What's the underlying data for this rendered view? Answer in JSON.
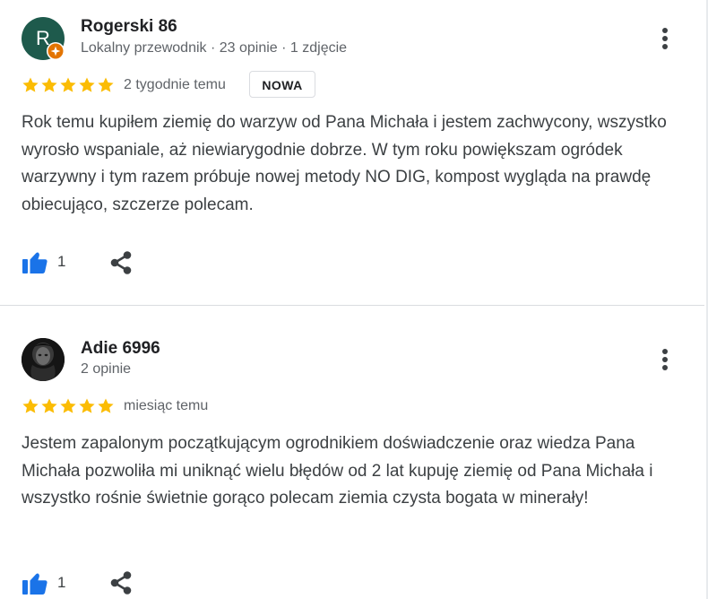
{
  "reviews": [
    {
      "avatar_letter": "R",
      "avatar_color": "#1e5a4c",
      "reviewer_name": "Rogerski 86",
      "reviewer_meta": "Lokalny przewodnik · 23 opinie · 1 zdjęcie",
      "badge_icon": "local-guide-badge-icon",
      "rating": 5,
      "rating_max": 5,
      "date": "2 tygodnie temu",
      "new_badge": "NOWA",
      "text": "Rok temu kupiłem ziemię do warzyw od Pana Michała i jestem zachwycony, wszystko wyrosło wspaniale, aż niewiarygodnie dobrze. W tym roku powiększam ogródek warzywny i tym razem próbuje nowej metody NO DIG, kompost wygląda na prawdę obiecująco, szczerze polecam.",
      "likes": "1"
    },
    {
      "avatar_letter": "",
      "avatar_color": "#1b1b1b",
      "reviewer_name": "Adie 6996",
      "reviewer_meta": "2 opinie",
      "rating": 5,
      "rating_max": 5,
      "date": "miesiąc temu",
      "text": "Jestem zapalonym początkującym ogrodnikiem doświadczenie oraz wiedza Pana Michała pozwoliła mi uniknąć wielu błędów od 2 lat kupuję ziemię od Pana Michała i wszystko rośnie świetnie gorąco polecam ziemia czysta bogata w minerały!",
      "likes": "1"
    }
  ],
  "colors": {
    "star": "#fbbc04",
    "like_icon": "#1a73e8",
    "text": "#3c4043",
    "meta": "#5f6368",
    "divider": "#dadce0"
  },
  "icons": {
    "star": "star-icon",
    "like": "thumbs-up-icon",
    "share": "share-icon",
    "more": "more-vert-icon"
  }
}
